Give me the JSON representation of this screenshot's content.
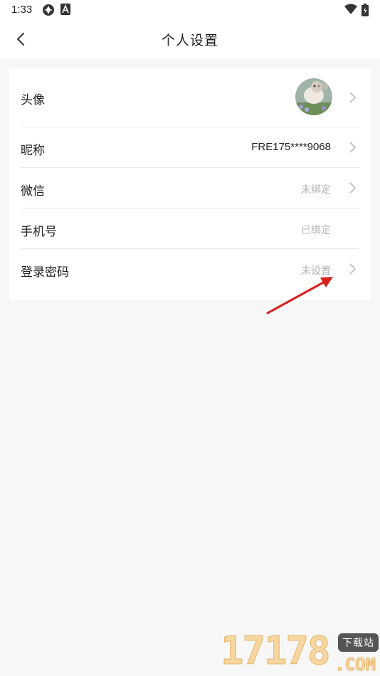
{
  "status_bar": {
    "time": "1:33"
  },
  "app_bar": {
    "title": "个人设置"
  },
  "settings": {
    "rows": [
      {
        "label": "头像",
        "value": ""
      },
      {
        "label": "昵称",
        "value": "FRE175****9068"
      },
      {
        "label": "微信",
        "value": "未绑定"
      },
      {
        "label": "手机号",
        "value": "已绑定"
      },
      {
        "label": "登录密码",
        "value": "未设置"
      }
    ]
  },
  "watermark": {
    "digits": "17178",
    "badge": "下载站",
    "domain": ".COM"
  },
  "colors": {
    "page_bg": "#f7f7f7",
    "card_bg": "#ffffff",
    "muted_text": "#b3b3b3",
    "annotation_arrow": "#d9201f"
  }
}
